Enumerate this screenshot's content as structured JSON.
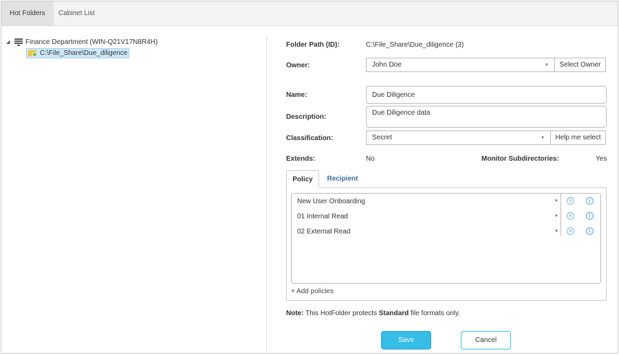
{
  "tabs": [
    {
      "label": "Hot Folders",
      "active": true
    },
    {
      "label": "Cabinet List",
      "active": false
    }
  ],
  "tree": {
    "root": {
      "label": "Finance Department (WIN-Q21V17N8R4H)",
      "icon": "server-icon",
      "expanded": true
    },
    "child": {
      "label": "C:\\File_Share\\Due_diligence",
      "icon": "folder-icon",
      "selected": true
    }
  },
  "form": {
    "folder_path_label": "Folder Path (ID):",
    "folder_path_value": "C:\\File_Share\\Due_diligence (3)",
    "owner_label": "Owner:",
    "owner_value": "John Doe",
    "select_owner_button": "Select Owner",
    "name_label": "Name:",
    "name_value": "Due Diligence",
    "description_label": "Description:",
    "description_value": "Due Diligence data",
    "classification_label": "Classification:",
    "classification_value": "Secret",
    "help_me_select_button": "Help me select",
    "extends_label": "Extends:",
    "extends_value": "No",
    "monitor_subdirectories_label": "Monitor Subdirectories:",
    "monitor_subdirectories_value": "Yes"
  },
  "policy_tabs": [
    {
      "label": "Policy",
      "active": true
    },
    {
      "label": "Recipient",
      "active": false
    }
  ],
  "policies": [
    {
      "name": "New User Onboarding"
    },
    {
      "name": "01 Internal Read"
    },
    {
      "name": "02 External Read"
    }
  ],
  "add_policies_label": "+ Add policies",
  "note": {
    "prefix": "Note:",
    "text_before": " This HotFolder protects ",
    "emphasis": "Standard",
    "text_after": " file formats only."
  },
  "actions": {
    "save_label": "Save",
    "cancel_label": "Cancel"
  },
  "colors": {
    "accent": "#35bde6",
    "link": "#3a6ea5",
    "selection": "#cde8f7",
    "icon_blue": "#5aa4dc"
  }
}
